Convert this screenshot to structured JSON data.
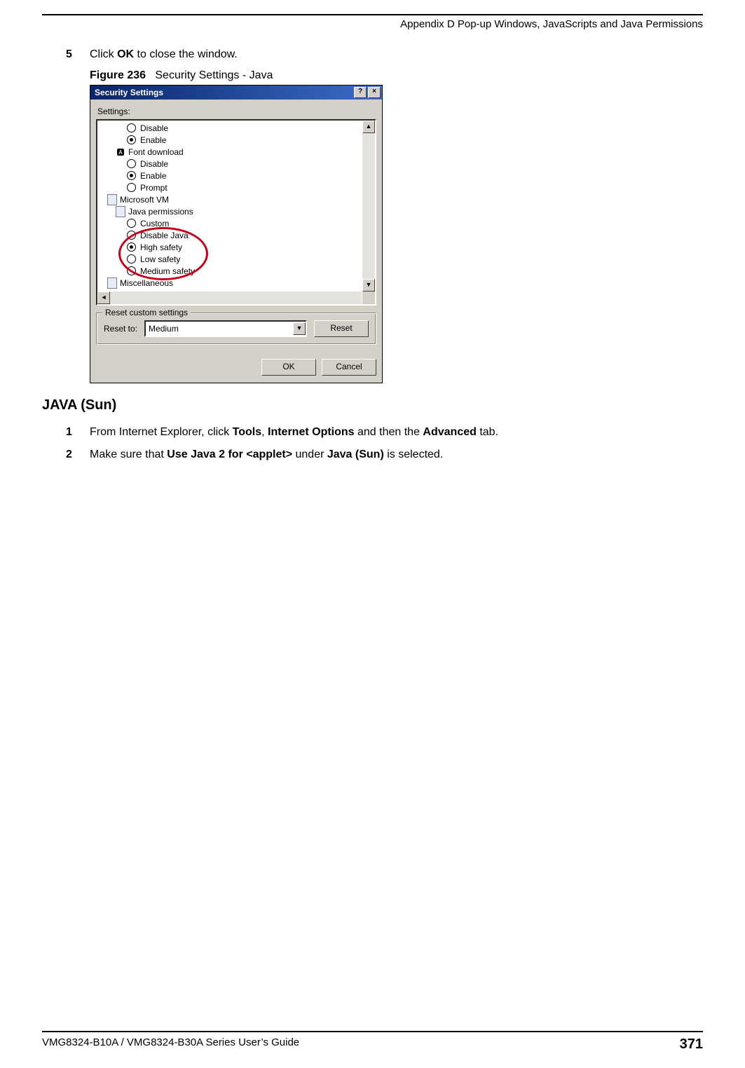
{
  "header": {
    "appendix": "Appendix D Pop-up Windows, JavaScripts and Java Permissions"
  },
  "step5": {
    "num": "5",
    "pre": "Click ",
    "bold": "OK",
    "post": " to close the window."
  },
  "figure": {
    "label": "Figure 236",
    "title": "Security Settings - Java"
  },
  "dialog": {
    "title": "Security Settings",
    "settings_label": "Settings:",
    "tree": {
      "items": [
        "Disable",
        "Enable",
        "Font download",
        "Disable",
        "Enable",
        "Prompt",
        "Microsoft VM",
        "Java permissions",
        "Custom",
        "Disable Java",
        "High safety",
        "Low safety",
        "Medium safety",
        "Miscellaneous"
      ]
    },
    "groupbox": {
      "legend": "Reset custom settings",
      "reset_to_label": "Reset to:",
      "combo_value": "Medium",
      "reset_btn": "Reset"
    },
    "ok": "OK",
    "cancel": "Cancel"
  },
  "section": "JAVA (Sun)",
  "step1": {
    "num": "1",
    "t1": "From Internet Explorer, click ",
    "b1": "Tools",
    "t2": ", ",
    "b2": "Internet Options",
    "t3": " and then the ",
    "b3": "Advanced",
    "t4": " tab."
  },
  "step2": {
    "num": "2",
    "t1": "Make sure that ",
    "b1": "Use Java 2 for <applet>",
    "t2": " under ",
    "b2": "Java (Sun)",
    "t3": " is selected."
  },
  "footer": {
    "guide": "VMG8324-B10A / VMG8324-B30A Series User’s Guide",
    "page": "371"
  }
}
